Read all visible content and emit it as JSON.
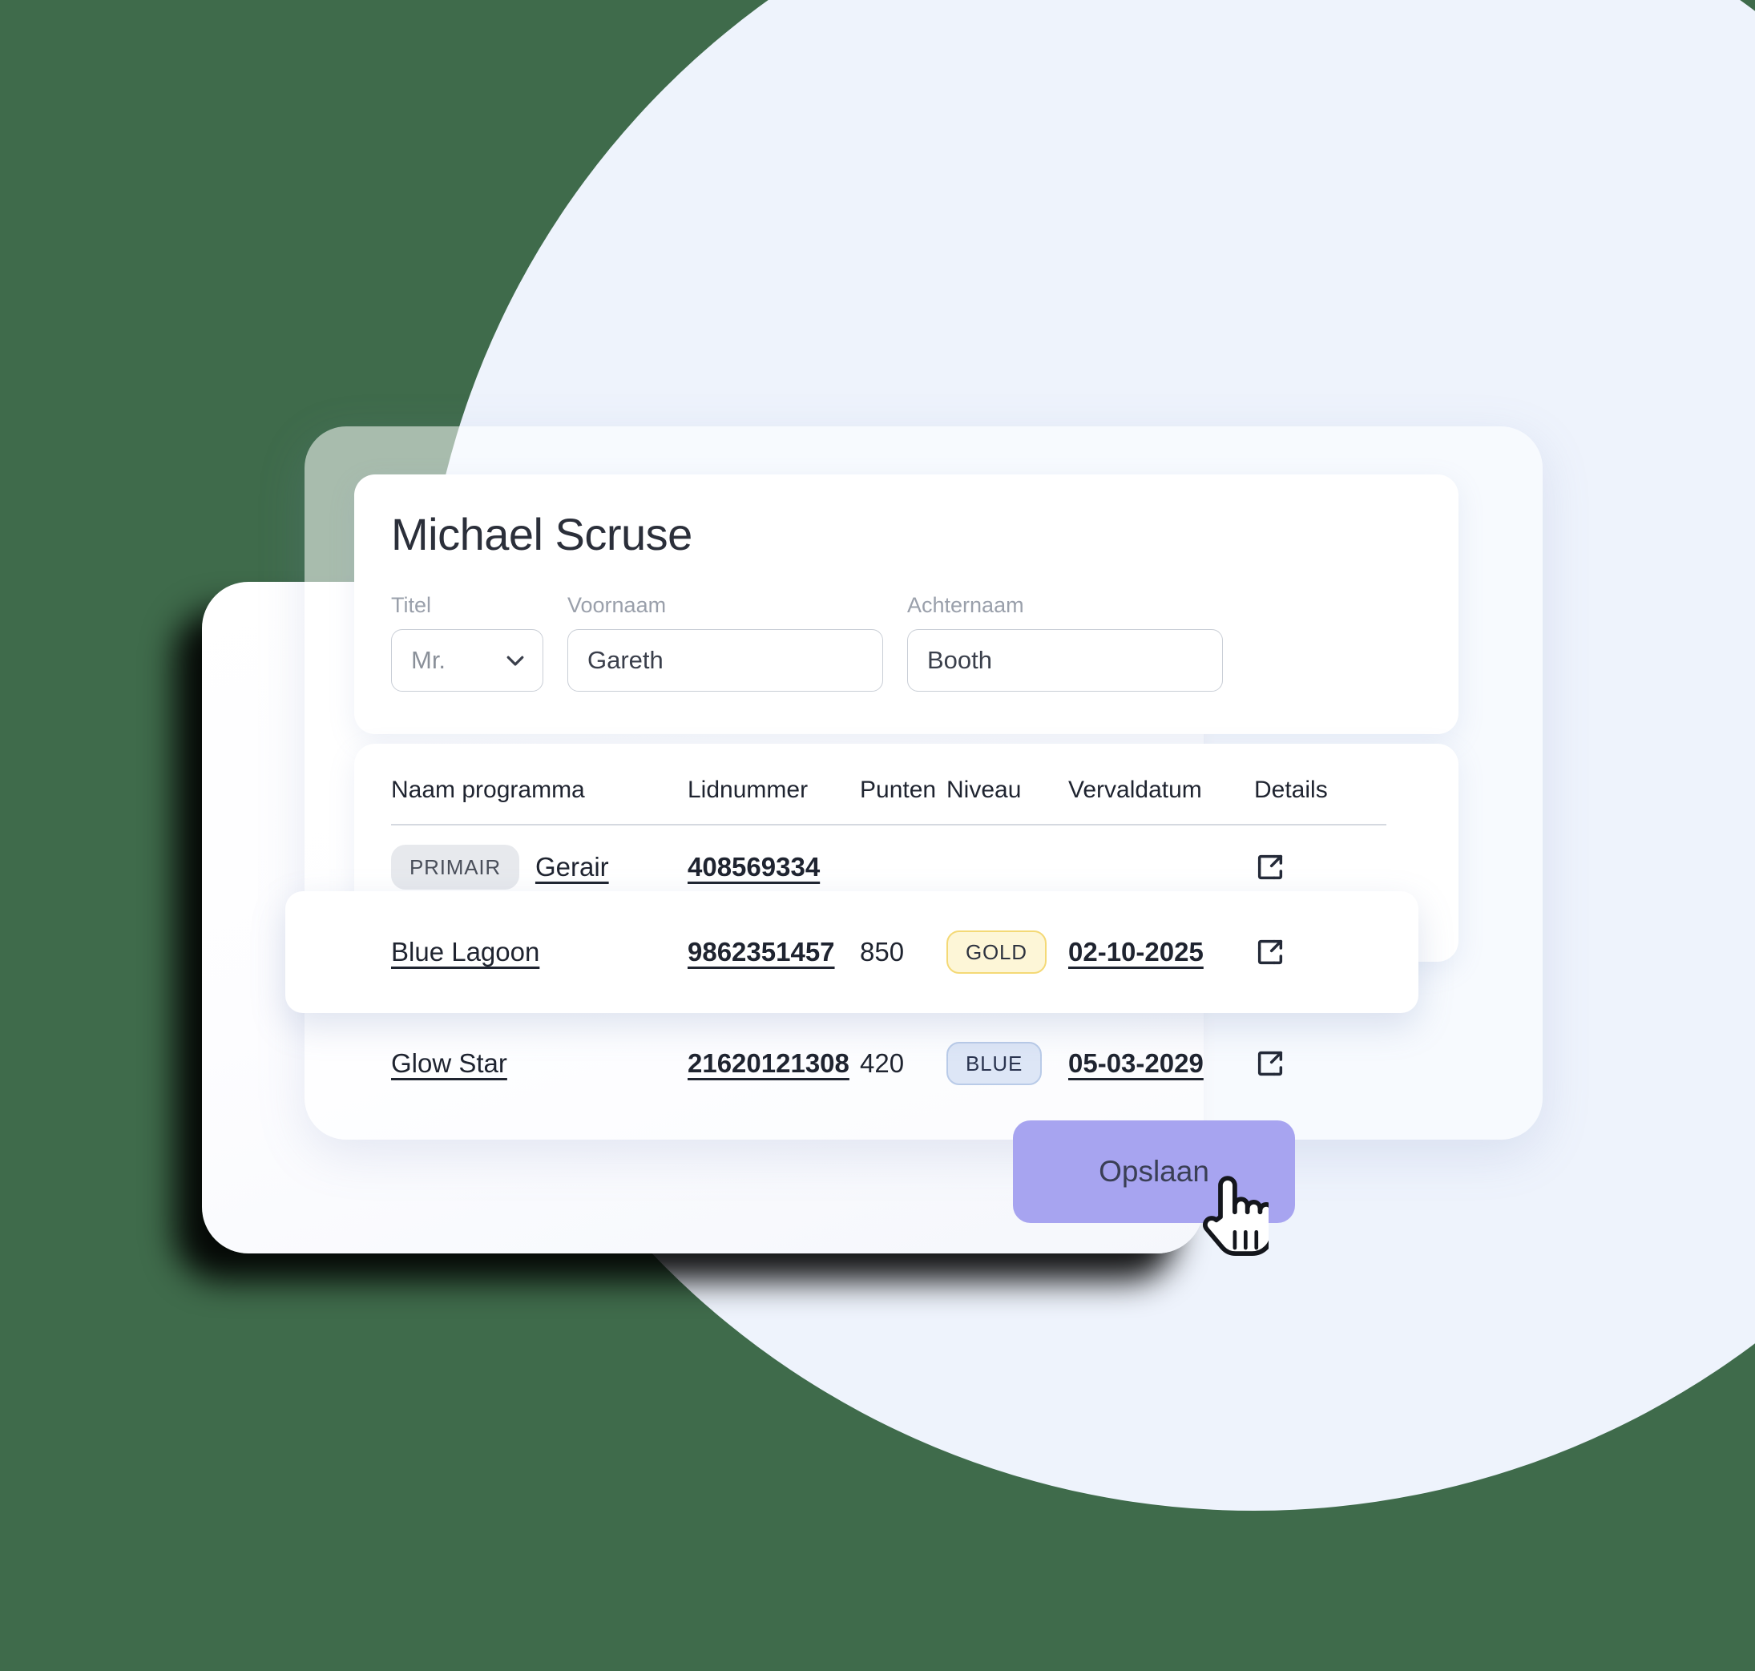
{
  "theme": {
    "page_background": "#3f6b4b",
    "circle_color": "#eef3fc",
    "accent_button": "#a7a4f0",
    "badge_gold_bg": "#fdf6d7",
    "badge_gold_border": "#f4d976",
    "badge_blue_bg": "#dde6f6",
    "badge_blue_border": "#b9cbe8",
    "badge_gray_bg": "#e7e9ed"
  },
  "profile": {
    "name": "Michael Scruse",
    "fields": [
      {
        "label": "Titel",
        "value": "Mr.",
        "placeholder": "Titel",
        "type": "select",
        "icon": "chevron-down-icon"
      },
      {
        "label": "Voornaam",
        "value": "Gareth",
        "placeholder": "Voornaam",
        "type": "text"
      },
      {
        "label": "Achternaam",
        "value": "Booth",
        "placeholder": "Achternaam",
        "type": "text"
      }
    ]
  },
  "table": {
    "columns": [
      "Naam programma",
      "Lidnummer",
      "Punten",
      "Niveau",
      "Vervaldatum",
      "Details"
    ],
    "rows": [
      {
        "tag": "PRIMAIR",
        "program": "Gerair",
        "membership_number": "408569334",
        "points": "",
        "level": "",
        "expiry_date": "",
        "details_icon": "external-link-icon"
      },
      {
        "tag": "",
        "program": "Blue Lagoon",
        "membership_number": "9862351457",
        "points": "850",
        "level": "GOLD",
        "expiry_date": "02-10-2025",
        "details_icon": "external-link-icon"
      },
      {
        "tag": "",
        "program": "Glow Star",
        "membership_number": "21620121308",
        "points": "420",
        "level": "BLUE",
        "expiry_date": "05-03-2029",
        "details_icon": "external-link-icon"
      }
    ]
  },
  "actions": {
    "save_label": "Opslaan"
  },
  "cursor": {
    "icon": "pointing-hand-cursor"
  }
}
